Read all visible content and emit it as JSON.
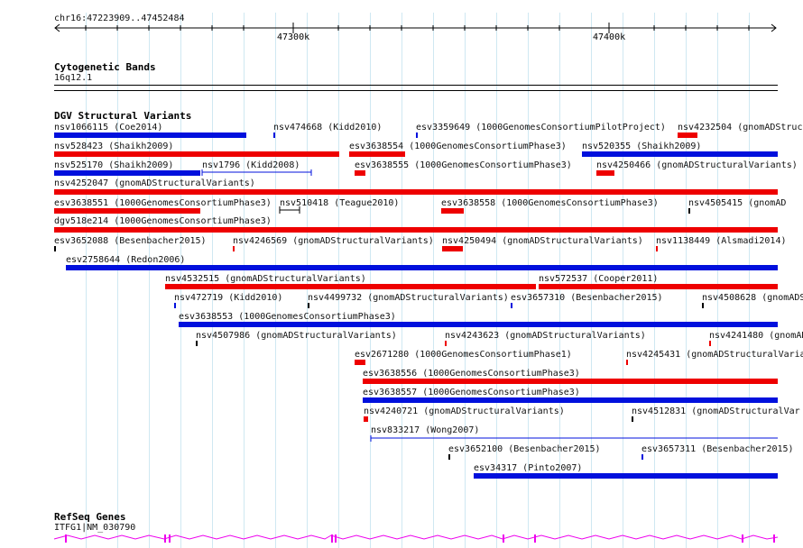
{
  "ruler": {
    "location": "chr16:47223909..47452484",
    "ticks": [
      "47300k",
      "47400k"
    ]
  },
  "cytoband": {
    "title": "Cytogenetic Bands",
    "band": "16q12.1"
  },
  "dgv": {
    "title": "DGV Structural Variants",
    "labels": [
      "nsv1066115 (Coe2014)",
      "nsv474668 (Kidd2010)",
      "esv3359649 (1000GenomesConsortiumPilotProject)",
      "nsv4232504 (gnomADStruc",
      "nsv528423 (Shaikh2009)",
      "esv3638554 (1000GenomesConsortiumPhase3)",
      "nsv520355 (Shaikh2009)",
      "nsv525170 (Shaikh2009)",
      "nsv1796 (Kidd2008)",
      "esv3638555 (1000GenomesConsortiumPhase3)",
      "nsv4250466 (gnomADStructuralVariants)",
      "nsv4252047 (gnomADStructuralVariants)",
      "esv3638551 (1000GenomesConsortiumPhase3)",
      "nsv510418 (Teague2010)",
      "esv3638558 (1000GenomesConsortiumPhase3)",
      "nsv4505415 (gnomAD",
      "dgv518e214 (1000GenomesConsortiumPhase3)",
      "esv3652088 (Besenbacher2015)",
      "nsv4246569 (gnomADStructuralVariants)",
      "nsv4250494 (gnomADStructuralVariants)",
      "nsv1138449 (Alsmadi2014)",
      "esv2758644 (Redon2006)",
      "nsv4532515 (gnomADStructuralVariants)",
      "nsv572537 (Cooper2011)",
      "nsv472719 (Kidd2010)",
      "nsv4499732 (gnomADStructuralVariants)",
      "esv3657310 (Besenbacher2015)",
      "nsv4508628 (gnomADS",
      "esv3638553 (1000GenomesConsortiumPhase3)",
      "nsv4507986 (gnomADStructuralVariants)",
      "nsv4243623 (gnomADStructuralVariants)",
      "nsv4241480 (gnomADS",
      "esv2671280 (1000GenomesConsortiumPhase1)",
      "nsv4245431 (gnomADStructuralVaria",
      "esv3638556 (1000GenomesConsortiumPhase3)",
      "esv3638557 (1000GenomesConsortiumPhase3)",
      "nsv4240721 (gnomADStructuralVariants)",
      "nsv4512831 (gnomADStructuralVar",
      "nsv833217 (Wong2007)",
      "esv3652100 (Besenbacher2015)",
      "esv3657311 (Besenbacher2015)",
      "esv34317 (Pinto2007)"
    ]
  },
  "refseq": {
    "title": "RefSeq Genes",
    "gene": "ITFG1|NM_030790"
  },
  "colors": {
    "loss": "#ee0000",
    "gain": "#0010dd",
    "gene": "#ee00ee",
    "grid": "#cfe8f2"
  }
}
